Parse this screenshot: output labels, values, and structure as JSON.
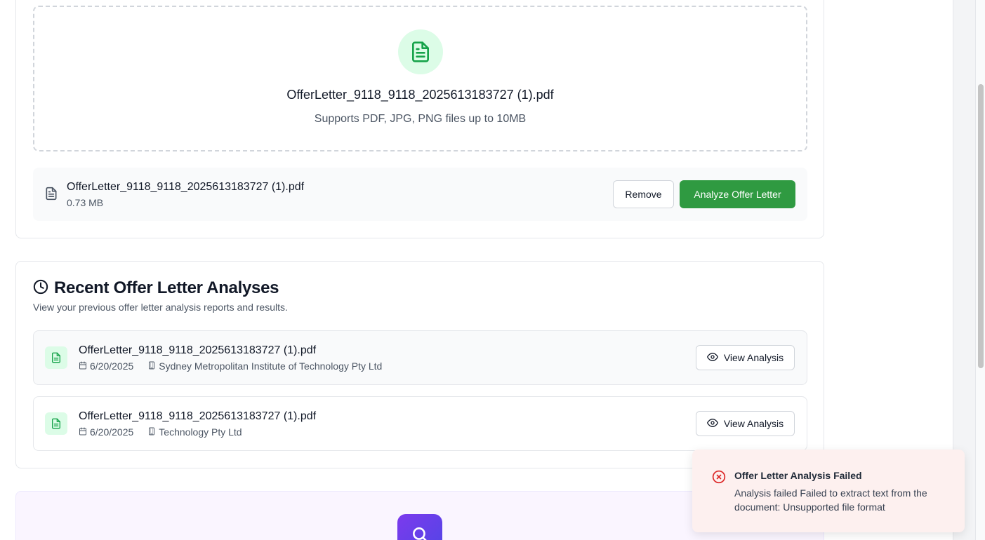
{
  "upload": {
    "dropzone_filename": "OfferLetter_9118_9118_2025613183727 (1).pdf",
    "dropzone_hint": "Supports PDF, JPG, PNG files up to 10MB",
    "selected_file": {
      "name": "OfferLetter_9118_9118_2025613183727 (1).pdf",
      "size": "0.73 MB"
    },
    "remove_label": "Remove",
    "analyze_label": "Analyze Offer Letter"
  },
  "recent": {
    "title": "Recent Offer Letter Analyses",
    "description": "View your previous offer letter analysis reports and results.",
    "items": [
      {
        "filename": "OfferLetter_9118_9118_2025613183727 (1).pdf",
        "date": "6/20/2025",
        "company": "Sydney Metropolitan Institute of Technology Pty Ltd",
        "action_label": "View Analysis"
      },
      {
        "filename": "OfferLetter_9118_9118_2025613183727 (1).pdf",
        "date": "6/20/2025",
        "company": "Technology Pty Ltd",
        "action_label": "View Analysis"
      }
    ]
  },
  "toast": {
    "title": "Offer Letter Analysis Failed",
    "message": "Analysis failed Failed to extract text from the document: Unsupported file format"
  },
  "icons": {
    "dropzone": "file-text-icon",
    "selected_file": "file-text-icon",
    "recent_title": "clock-icon",
    "item": "file-text-icon",
    "date": "calendar-icon",
    "company": "building-icon",
    "view": "eye-icon",
    "toast": "x-circle-icon",
    "promo": "search-icon"
  },
  "colors": {
    "primary_green": "#2f9a41",
    "icon_green_bg": "#dcfce7",
    "toast_bg": "#fdf0ef",
    "error_red": "#dc2626"
  }
}
